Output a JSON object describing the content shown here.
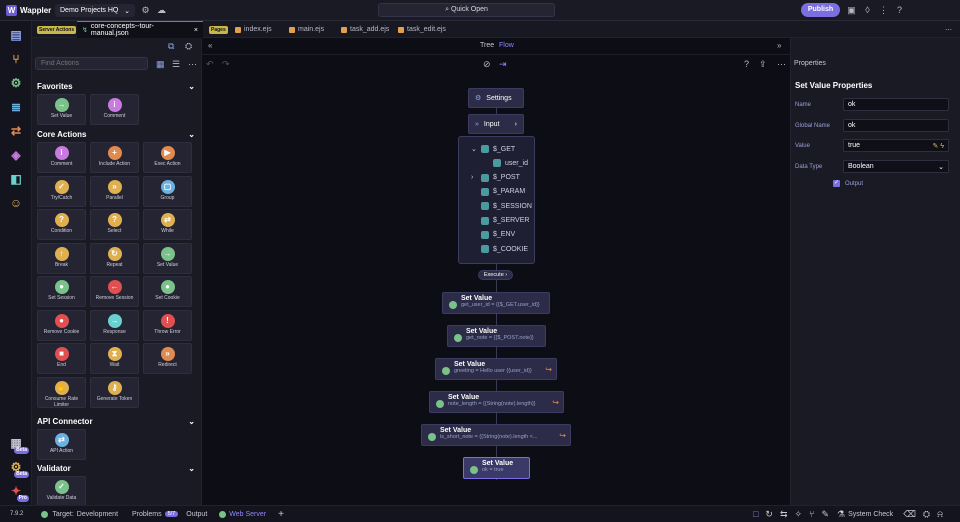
{
  "app": {
    "name": "Wappler",
    "project": "Demo Projects HQ",
    "quick_open": "Quick Open",
    "publish": "Publish",
    "version": "7.9.2"
  },
  "tabs": {
    "server_actions_badge": "Server Actions",
    "active_file": "core-concepts--tour-manual.json",
    "pages_badge": "Pages",
    "files": [
      "index.ejs",
      "main.ejs",
      "task_add.ejs",
      "task_edit.ejs"
    ]
  },
  "left": {
    "search_placeholder": "Find Actions",
    "favorites_title": "Favorites",
    "favorites": [
      "Set Value",
      "Comment"
    ],
    "core_title": "Core Actions",
    "core": [
      "Comment",
      "Include Action",
      "Exec Action",
      "Try/Catch",
      "Parallel",
      "Group",
      "Condition",
      "Select",
      "While",
      "Break",
      "Repeat",
      "Set Value",
      "Set Session",
      "Remove Session",
      "Set Cookie",
      "Remove Cookie",
      "Response",
      "Throw Error",
      "End",
      "Wait",
      "Redirect",
      "Consume Rate Limiter",
      "Generate Token"
    ],
    "api_title": "API Connector",
    "api": [
      "API Action"
    ],
    "validator_title": "Validator",
    "validator": [
      "Validate Data"
    ]
  },
  "canvas": {
    "view_tree": "Tree",
    "view_flow": "Flow",
    "settings": "Settings",
    "input": "Input",
    "input_items": [
      "$_GET",
      "user_id",
      "$_POST",
      "$_PARAM",
      "$_SESSION",
      "$_SERVER",
      "$_ENV",
      "$_COOKIE"
    ],
    "execute": "Execute",
    "steps": [
      {
        "title": "Set Value",
        "sub": "get_user_id = {{$_GET.user_id}}"
      },
      {
        "title": "Set Value",
        "sub": "get_note = {{$_POST.note}}"
      },
      {
        "title": "Set Value",
        "sub": "greeting = Hello user {{user_id}}"
      },
      {
        "title": "Set Value",
        "sub": "note_length = {{String(note).length}}"
      },
      {
        "title": "Set Value",
        "sub": "is_short_note = {{String(note).length <..."
      },
      {
        "title": "Set Value",
        "sub": "ok = true"
      }
    ]
  },
  "properties": {
    "panel_title": "Properties",
    "title": "Set Value Properties",
    "name_label": "Name",
    "name_value": "ok",
    "global_label": "Global Name",
    "global_value": "ok",
    "value_label": "Value",
    "value_value": "true",
    "type_label": "Data Type",
    "type_value": "Boolean",
    "output_label": "Output"
  },
  "status": {
    "target_label": "Target:",
    "target_value": "Development",
    "problems": "Problems",
    "problems_count": "5/7",
    "output": "Output",
    "web_server": "Web Server",
    "system_check": "System Check"
  },
  "colors": {
    "accent": "#7b6ee0",
    "panel": "#1a1a24",
    "canvas": "#0d0d15",
    "node": "#2c2c48"
  }
}
